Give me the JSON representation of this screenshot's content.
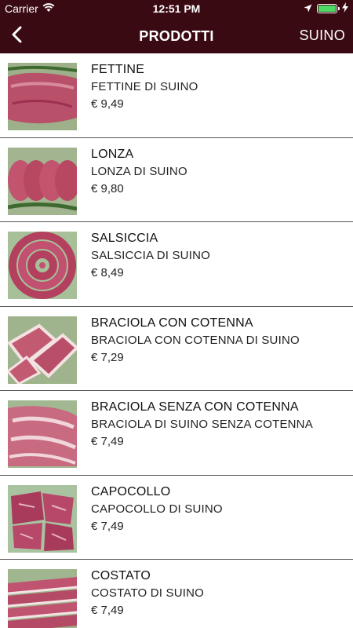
{
  "status_bar": {
    "carrier": "Carrier",
    "time": "12:51 PM",
    "battery_color": "#4cd964"
  },
  "nav": {
    "back_icon": "chevron-left-icon",
    "title": "PRODOTTI",
    "right_label": "SUINO",
    "bar_color": "#3a0a12"
  },
  "products": [
    {
      "name": "FETTINE",
      "description": "FETTINE DI SUINO",
      "price": "€ 9,49"
    },
    {
      "name": "LONZA",
      "description": "LONZA DI SUINO",
      "price": "€ 9,80"
    },
    {
      "name": "SALSICCIA",
      "description": "SALSICCIA DI SUINO",
      "price": "€ 8,49"
    },
    {
      "name": "BRACIOLA CON COTENNA",
      "description": "BRACIOLA CON COTENNA DI SUINO",
      "price": "€ 7,29"
    },
    {
      "name": "BRACIOLA SENZA CON COTENNA",
      "description": "BRACIOLA DI SUINO SENZA COTENNA",
      "price": "€ 7,49"
    },
    {
      "name": "CAPOCOLLO",
      "description": "CAPOCOLLO DI SUINO",
      "price": "€ 7,49"
    },
    {
      "name": "COSTATO",
      "description": "COSTATO DI SUINO",
      "price": "€ 7,49"
    }
  ]
}
